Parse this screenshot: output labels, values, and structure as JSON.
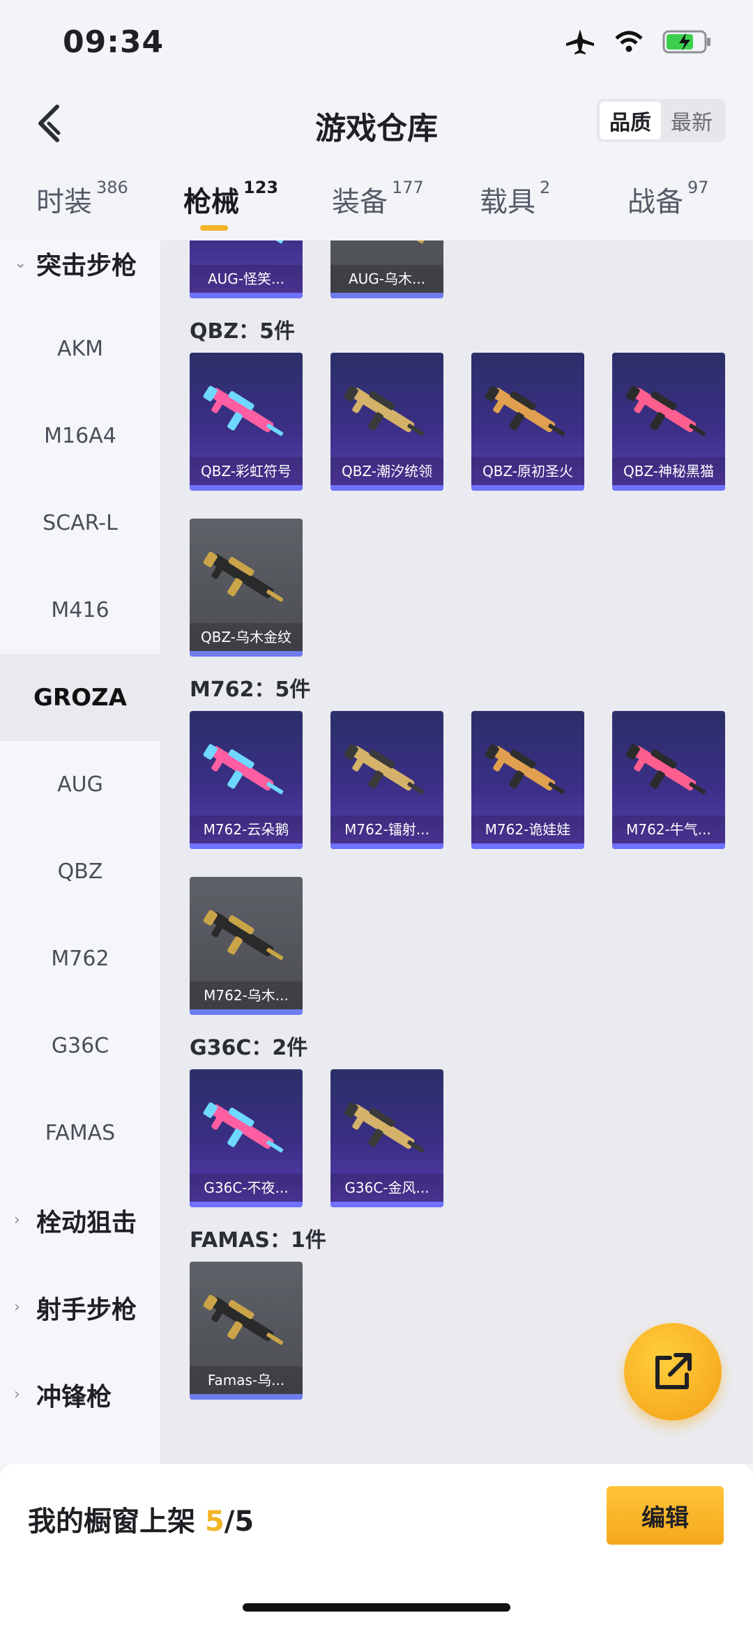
{
  "status_bar": {
    "time": "09:34"
  },
  "header": {
    "title": "游戏仓库",
    "sort_options": [
      "品质",
      "最新"
    ],
    "sort_active": "品质"
  },
  "tabs": [
    {
      "label": "时装",
      "count": "386"
    },
    {
      "label": "枪械",
      "count": "123"
    },
    {
      "label": "装备",
      "count": "177"
    },
    {
      "label": "载具",
      "count": "2"
    },
    {
      "label": "战备",
      "count": "97"
    }
  ],
  "active_tab": "枪械",
  "sidebar": {
    "items": [
      {
        "label": "突击步枪",
        "type": "group",
        "expanded": true
      },
      {
        "label": "AKM",
        "type": "sub"
      },
      {
        "label": "M16A4",
        "type": "sub"
      },
      {
        "label": "SCAR-L",
        "type": "sub"
      },
      {
        "label": "M416",
        "type": "sub"
      },
      {
        "label": "GROZA",
        "type": "sub",
        "selected": true
      },
      {
        "label": "AUG",
        "type": "sub"
      },
      {
        "label": "QBZ",
        "type": "sub"
      },
      {
        "label": "M762",
        "type": "sub"
      },
      {
        "label": "G36C",
        "type": "sub"
      },
      {
        "label": "FAMAS",
        "type": "sub"
      },
      {
        "label": "栓动狙击",
        "type": "group"
      },
      {
        "label": "射手步枪",
        "type": "group"
      },
      {
        "label": "冲锋枪",
        "type": "group"
      }
    ]
  },
  "sections": [
    {
      "label": "",
      "items": [
        {
          "name": "AUG-怪笑...",
          "rarity": "purple"
        },
        {
          "name": "AUG-乌木...",
          "rarity": "gray"
        }
      ]
    },
    {
      "label": "QBZ：5件",
      "items": [
        {
          "name": "QBZ-彩虹符号",
          "rarity": "purple"
        },
        {
          "name": "QBZ-潮汐统领",
          "rarity": "purple"
        },
        {
          "name": "QBZ-原初圣火",
          "rarity": "purple"
        },
        {
          "name": "QBZ-神秘黑猫",
          "rarity": "purple"
        },
        {
          "name": "QBZ-乌木金纹",
          "rarity": "gray"
        }
      ]
    },
    {
      "label": "M762：5件",
      "items": [
        {
          "name": "M762-云朵鹅",
          "rarity": "purple"
        },
        {
          "name": "M762-镭射...",
          "rarity": "purple"
        },
        {
          "name": "M762-诡娃娃",
          "rarity": "purple"
        },
        {
          "name": "M762-牛气...",
          "rarity": "purple"
        },
        {
          "name": "M762-乌木...",
          "rarity": "gray"
        }
      ]
    },
    {
      "label": "G36C：2件",
      "items": [
        {
          "name": "G36C-不夜...",
          "rarity": "purple"
        },
        {
          "name": "G36C-金风...",
          "rarity": "purple"
        }
      ]
    },
    {
      "label": "FAMAS：1件",
      "items": [
        {
          "name": "Famas-乌...",
          "rarity": "gray"
        }
      ]
    }
  ],
  "bottom_bar": {
    "shelf_label": "我的橱窗上架",
    "shelf_current": "5",
    "shelf_total": "/5",
    "edit_label": "编辑"
  },
  "colors": {
    "accent": "#f2b527",
    "purple_card": "#3b2f86",
    "gray_card": "#4f5157",
    "rarity_bar": "#6e72ff"
  }
}
